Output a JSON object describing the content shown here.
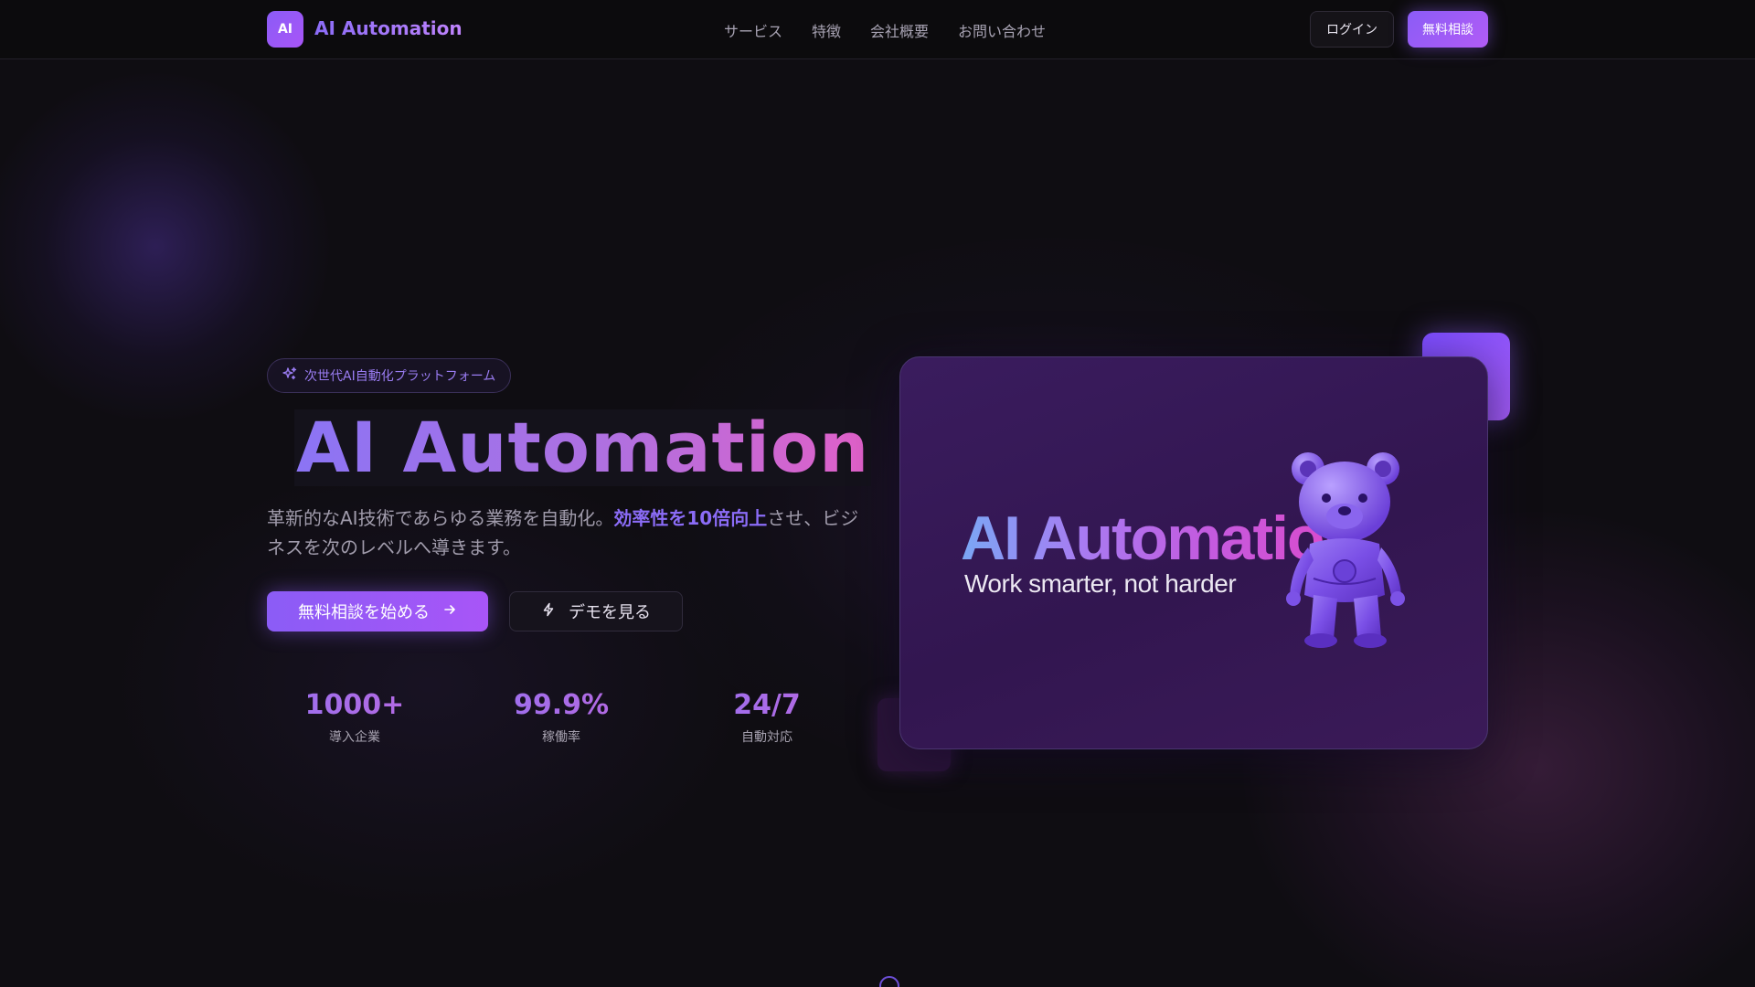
{
  "header": {
    "logo_badge": "AI",
    "brand": "AI Automation",
    "nav": [
      "サービス",
      "特徴",
      "会社概要",
      "お問い合わせ"
    ],
    "login_label": "ログイン",
    "consult_label": "無料相談"
  },
  "hero": {
    "pill_label": "次世代AI自動化プラットフォーム",
    "title": "AI Automation",
    "desc_part1": "革新的なAI技術であらゆる業務を自動化。",
    "desc_highlight": "効率性を10倍向上",
    "desc_part2": "させ、ビジネスを次のレベルへ導きます。",
    "primary_cta": "無料相談を始める",
    "demo_cta": "デモを見る",
    "stats": [
      {
        "value": "1000+",
        "label": "導入企業"
      },
      {
        "value": "99.9%",
        "label": "稼働率"
      },
      {
        "value": "24/7",
        "label": "自動対応"
      }
    ]
  },
  "card": {
    "title": "AI Automation",
    "subtitle": "Work smarter, not harder",
    "image": "purple-robot-bear-figure"
  },
  "icons": {
    "pill": "sparkles-icon",
    "primary_cta": "arrow-right-icon",
    "demo_cta": "lightning-icon"
  },
  "colors": {
    "accent": "#8b5cf6",
    "accent_pink": "#e060c8",
    "background": "#0f0d12"
  }
}
